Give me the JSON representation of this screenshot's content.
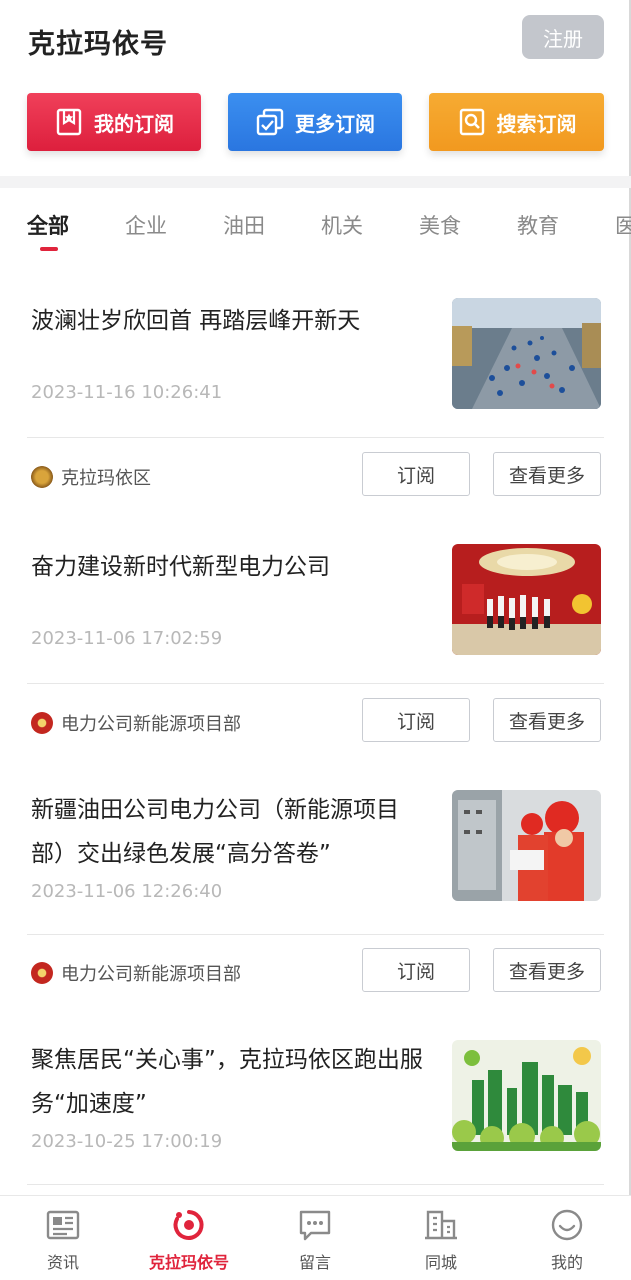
{
  "header": {
    "title": "克拉玛依号",
    "register_label": "注册"
  },
  "actions": {
    "my_subscriptions": "我的订阅",
    "more_subscriptions": "更多订阅",
    "search_subscriptions": "搜索订阅"
  },
  "tabs": [
    "全部",
    "企业",
    "油田",
    "机关",
    "美食",
    "教育",
    "医"
  ],
  "articles": [
    {
      "title": "波澜壮岁欣回首 再踏层峰开新天",
      "date": "2023-11-16 10:26:41",
      "source": "克拉玛依区",
      "subscribe_label": "订阅",
      "more_label": "查看更多"
    },
    {
      "title": "奋力建设新时代新型电力公司",
      "date": "2023-11-06 17:02:59",
      "source": "电力公司新能源项目部",
      "subscribe_label": "订阅",
      "more_label": "查看更多"
    },
    {
      "title": "新疆油田公司电力公司（新能源项目部）交出绿色发展“高分答卷”",
      "date": "2023-11-06 12:26:40",
      "source": "电力公司新能源项目部",
      "subscribe_label": "订阅",
      "more_label": "查看更多"
    },
    {
      "title": "聚焦居民“关心事”，克拉玛依区跑出服务“加速度”",
      "date": "2023-10-25 17:00:19"
    }
  ],
  "tabbar": [
    {
      "label": "资讯",
      "icon": "newspaper-icon"
    },
    {
      "label": "克拉玛依号",
      "icon": "klmy-logo-icon"
    },
    {
      "label": "留言",
      "icon": "message-icon"
    },
    {
      "label": "同城",
      "icon": "building-icon"
    },
    {
      "label": "我的",
      "icon": "smile-icon"
    }
  ],
  "colors": {
    "accent_red": "#e0243c",
    "blue": "#2a76e0",
    "orange": "#f2991f",
    "register_gray": "#c3c6cc"
  }
}
